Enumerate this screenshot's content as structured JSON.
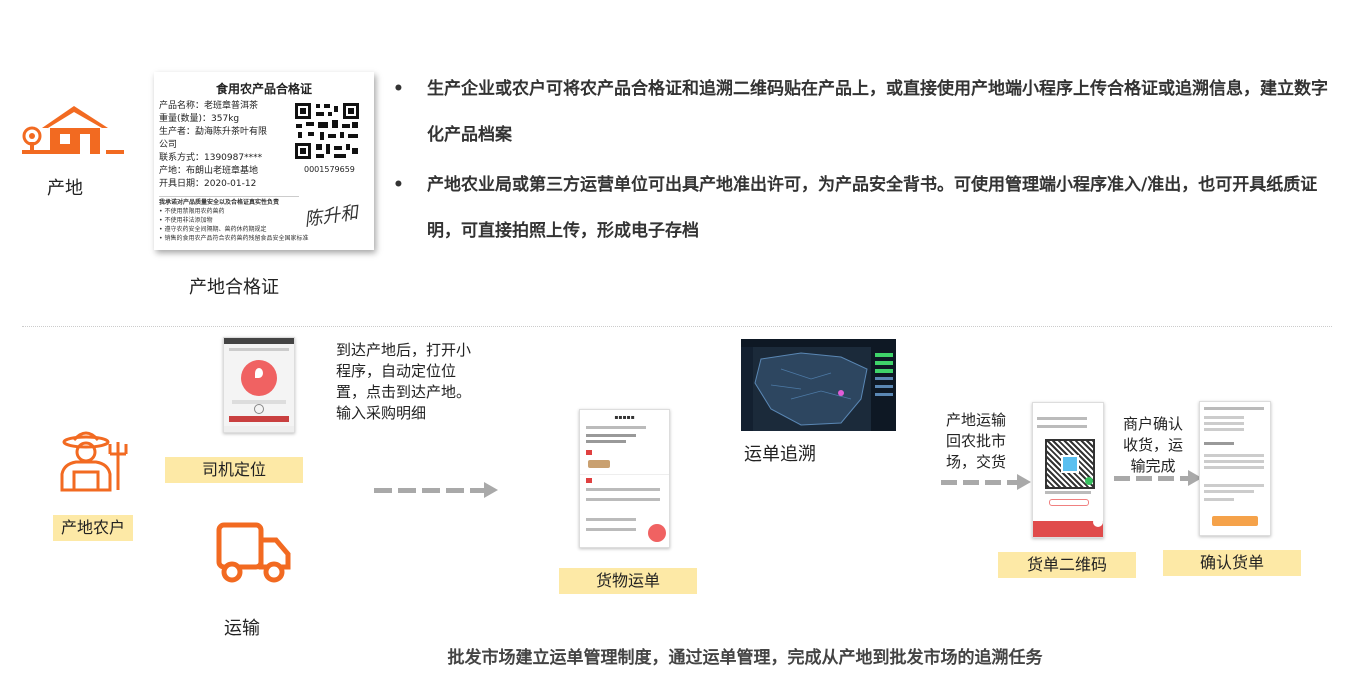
{
  "top": {
    "origin_label": "产地",
    "cert_caption": "产地合格证",
    "certificate": {
      "title": "食用农产品合格证",
      "rows": [
        "产品名称：老班章普洱茶",
        "重量(数量)：357kg",
        "生产者：勐海陈升茶叶有限",
        "公司",
        "联系方式：1390987****",
        "产地：布朗山老班章基地",
        "开具日期：2020-01-12"
      ],
      "qr_number": "0001579659",
      "notes": [
        "我承诺对产品质量安全以及合格证真实性负责",
        "• 不使用禁限用农药兽药",
        "• 不使用非法添加物",
        "• 遵守农药安全间隔期、兽药休药期规定",
        "• 销售的食用农产品符合农药兽药残留食品安全国家标准"
      ],
      "signature": "陈升和"
    },
    "bullets": [
      "生产企业或农户可将农产品合格证和追溯二维码贴在产品上，或直接使用产地端小程序上传合格证或追溯信息，建立数字化产品档案",
      "产地农业局或第三方运营单位可出具产地准出许可，为产品安全背书。可使用管理端小程序准入/准出，也可开具纸质证明，可直接拍照上传，形成电子存档"
    ]
  },
  "flow": {
    "farmer_label": "产地农户",
    "driver_label": "司机定位",
    "transport_label": "运输",
    "step1_text": "到达产地后，打开小程序，自动定位位置，点击到达产地。输入采购明细",
    "cargo_label": "货物运单",
    "trace_label": "运单追溯",
    "step2_text": "产地运输回农批市场，交货",
    "qr_label": "货单二维码",
    "step3_text": "商户确认收货，运输完成",
    "confirm_label": "确认货单",
    "footer": "批发市场建立运单管理制度，通过运单管理，完成从产地到批发市场的追溯任务"
  },
  "colors": {
    "accent": "#f26a21",
    "highlight": "#fde9a6",
    "arrow": "#a9a9a9"
  }
}
